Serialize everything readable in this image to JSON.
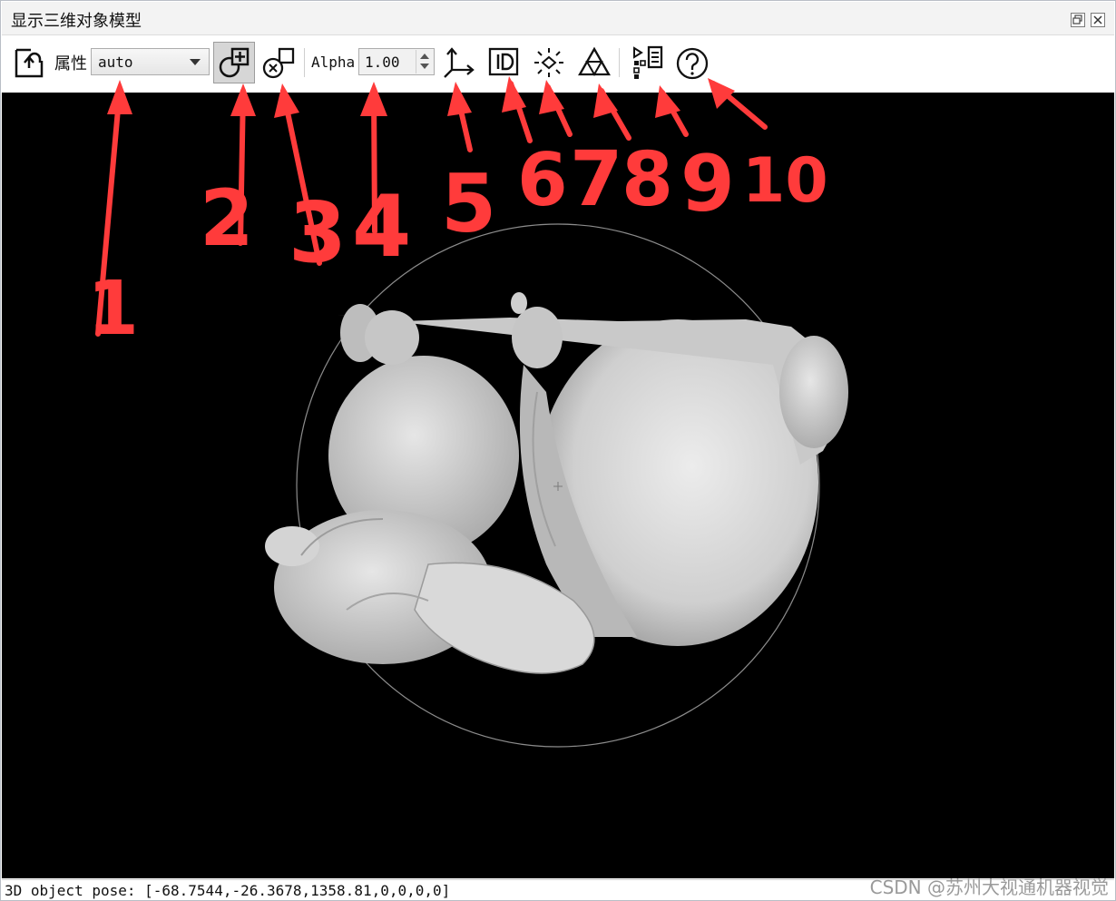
{
  "window": {
    "title": "显示三维对象模型",
    "restore_icon": "restore-icon",
    "close_icon": "close-icon"
  },
  "toolbar": {
    "reset_icon": "reset-view-icon",
    "property_label": "属性",
    "property_value": "auto",
    "add_object_icon": "add-object-icon",
    "remove_object_icon": "remove-object-icon",
    "alpha_label": "Alpha",
    "alpha_value": "1.00",
    "axes_icon": "coordinate-axes-icon",
    "id_icon": "object-id-icon",
    "light_icon": "lighting-icon",
    "triangles_icon": "triangle-mesh-icon",
    "export_icon": "export-list-icon",
    "help_icon": "help-icon"
  },
  "annotations": {
    "numbers": [
      "1",
      "2",
      "3",
      "4",
      "5",
      "6",
      "7",
      "8",
      "9",
      "10"
    ],
    "color": "#ff3b3b"
  },
  "viewport": {
    "background": "#000000",
    "model_color": "#d4d4d4"
  },
  "status": {
    "pose_text": "3D object pose: [-68.7544,-26.3678,1358.81,0,0,0,0]",
    "watermark": "CSDN @苏州大视通机器视觉"
  }
}
